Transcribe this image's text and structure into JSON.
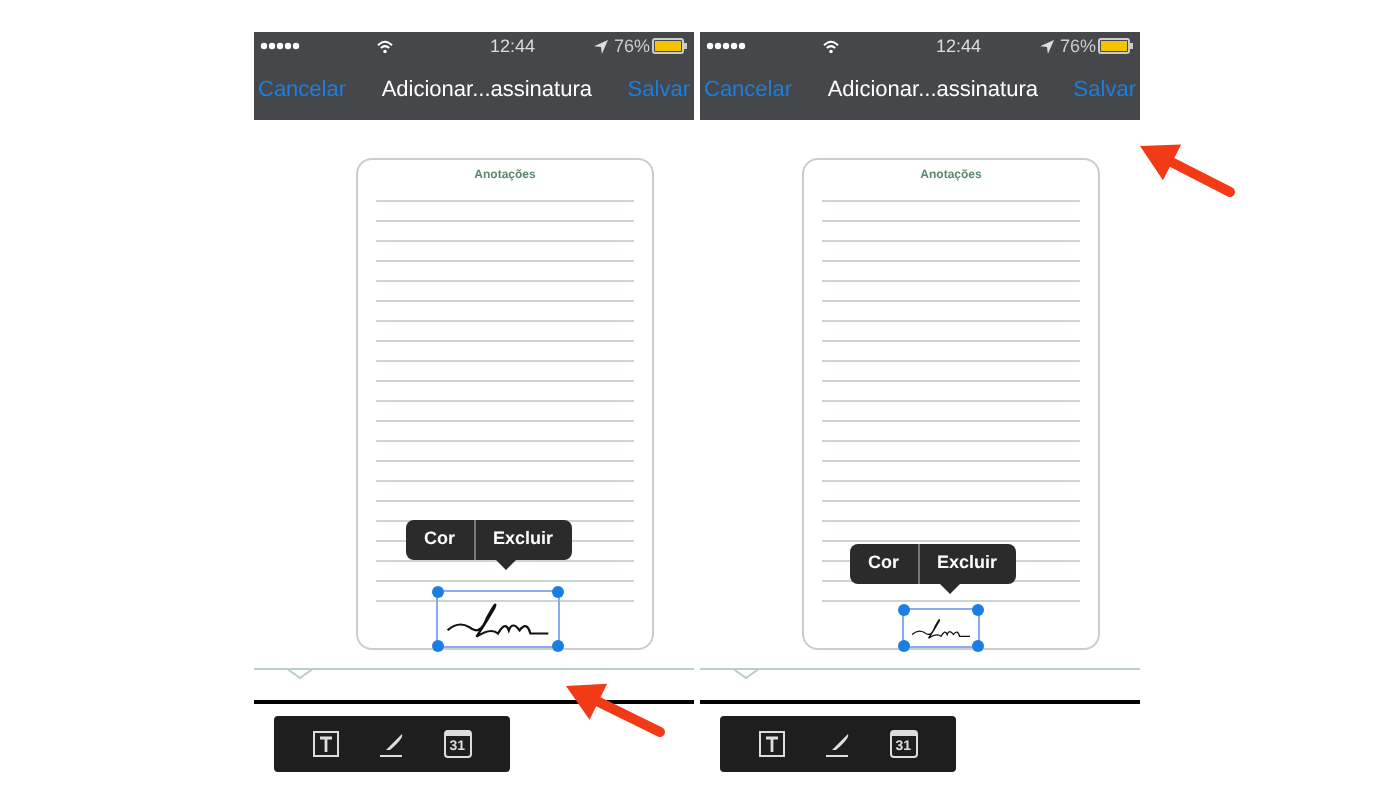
{
  "panels": [
    {
      "kind": "signing",
      "status_bar": {
        "time": "12:44",
        "battery": "76%"
      },
      "nav_bar": {
        "cancel": "Cancelar",
        "title": "Adicionar...assinatura",
        "save": "Salvar"
      },
      "card_title": "Anotações",
      "popup": [
        "Cor",
        "Excluir"
      ],
      "toolbar": {
        "calendar_day": "31"
      }
    },
    {
      "kind": "saving",
      "status_bar": {
        "time": "12:44",
        "battery": "76%"
      },
      "nav_bar": {
        "cancel": "Cancelar",
        "title": "Adicionar...assinatura",
        "save": "Salvar"
      },
      "card_title": "Anotações",
      "popup": [
        "Cor",
        "Excluir"
      ],
      "toolbar": {
        "calendar_day": "31"
      }
    }
  ]
}
